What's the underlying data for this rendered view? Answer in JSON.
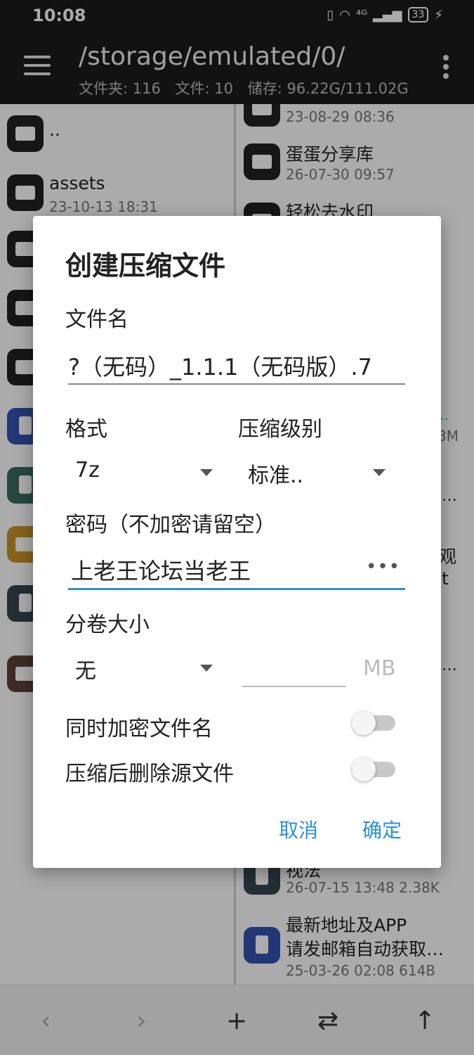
{
  "status_bar": {
    "time": "10:08",
    "signal_text": "⁴ᴳ",
    "battery": "33"
  },
  "app_bar": {
    "title": "/storage/emulated/0/",
    "stats": {
      "folders": "文件夹: 116",
      "files": "文件: 10",
      "storage": "储存: 96.22G/111.02G"
    }
  },
  "left_pane": {
    "items": [
      {
        "name": "..",
        "meta": ""
      },
      {
        "name": "assets",
        "meta": "23-10-13 18:31"
      }
    ]
  },
  "right_pane": {
    "items": [
      {
        "name": "",
        "meta": "23-08-29 08:36"
      },
      {
        "name": "蛋蛋分享库",
        "meta": "26-07-30 09:57"
      },
      {
        "name": "轻松去水印",
        "meta": ""
      },
      {
        "name": "…",
        "meta": ""
      },
      {
        "name": "3M",
        "meta": ""
      },
      {
        "name": "…",
        "meta": ""
      },
      {
        "name": "观",
        "meta": ""
      },
      {
        "name": "t",
        "meta": ""
      },
      {
        "name": "…",
        "meta": ""
      },
      {
        "name": "视法",
        "meta": "26-07-15 13:48  2.38K"
      },
      {
        "name": "最新地址及APP",
        "name2": "请发邮箱自动获取…",
        "meta": "25-03-26 02:08  614B"
      }
    ]
  },
  "dialog": {
    "title": "创建压缩文件",
    "filename_label": "文件名",
    "filename_value": "?（无码）_1.1.1（无码版）.7",
    "format_label": "格式",
    "format_value": "7z",
    "level_label": "压缩级别",
    "level_value": "标准..",
    "password_label": "密码（不加密请留空）",
    "password_value": "上老王论坛当老王",
    "password_dots": "•••",
    "volume_label": "分卷大小",
    "volume_value": "无",
    "volume_unit": "MB",
    "encrypt_names_label": "同时加密文件名",
    "delete_source_label": "压缩后删除源文件",
    "cancel": "取消",
    "ok": "确定"
  },
  "bottom_bar": {
    "back": "‹",
    "forward": "›",
    "add": "+",
    "swap": "⇄",
    "up": "↑"
  },
  "colors": {
    "accent": "#2b8fd6",
    "bar_dark": "#1c1c1c"
  }
}
